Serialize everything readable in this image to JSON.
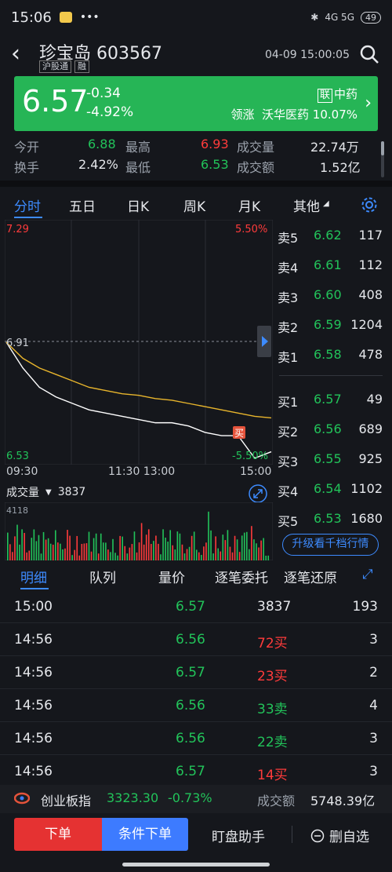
{
  "status": {
    "time": "15:06",
    "network": "4G 5G",
    "battery": "49"
  },
  "header": {
    "title": "珍宝岛 603567",
    "tags": [
      "沪股通",
      "融"
    ],
    "timestamp": "04-09 15:00:05"
  },
  "quote": {
    "price": "6.57",
    "change": "-0.34",
    "change_pct": "-4.92%",
    "sector": "中药",
    "sector_tag": "联",
    "leader_label": "领涨",
    "leader_name": "沃华医药",
    "leader_pct": "10.07%"
  },
  "stats": {
    "open_label": "今开",
    "open": "6.88",
    "high_label": "最高",
    "high": "6.93",
    "vol_label": "成交量",
    "vol": "22.74万",
    "turnover_label": "换手",
    "turnover": "2.42%",
    "low_label": "最低",
    "low": "6.53",
    "amount_label": "成交额",
    "amount": "1.52亿"
  },
  "tabs": [
    "分时",
    "五日",
    "日K",
    "周K",
    "月K",
    "其他"
  ],
  "chart_labels": {
    "top_price": "7.29",
    "top_pct": "5.50%",
    "ref_price": "6.91",
    "bottom_price": "6.53",
    "bottom_pct": "-5.50%",
    "buy_marker": "买",
    "time_start": "09:30",
    "time_mid": "11:30 13:00",
    "time_end": "15:00"
  },
  "chart_data": {
    "type": "line",
    "x": [
      "09:30",
      "09:45",
      "10:00",
      "10:15",
      "10:30",
      "10:45",
      "11:00",
      "11:15",
      "11:30",
      "13:15",
      "13:30",
      "13:45",
      "14:00",
      "14:15",
      "14:30",
      "14:45",
      "15:00"
    ],
    "series": [
      {
        "values": [
          6.91,
          6.83,
          6.77,
          6.74,
          6.72,
          6.7,
          6.69,
          6.68,
          6.67,
          6.66,
          6.66,
          6.65,
          6.63,
          6.62,
          6.62,
          6.55,
          6.57
        ]
      },
      {
        "values": [
          6.91,
          6.86,
          6.83,
          6.81,
          6.79,
          6.77,
          6.76,
          6.75,
          6.745,
          6.735,
          6.73,
          6.72,
          6.71,
          6.7,
          6.69,
          6.68,
          6.675
        ]
      }
    ],
    "ylim": [
      6.53,
      7.29
    ]
  },
  "orderbook": {
    "asks": [
      {
        "label": "卖5",
        "price": "6.62",
        "vol": "117"
      },
      {
        "label": "卖4",
        "price": "6.61",
        "vol": "112"
      },
      {
        "label": "卖3",
        "price": "6.60",
        "vol": "408"
      },
      {
        "label": "卖2",
        "price": "6.59",
        "vol": "1204"
      },
      {
        "label": "卖1",
        "price": "6.58",
        "vol": "478"
      }
    ],
    "bids": [
      {
        "label": "买1",
        "price": "6.57",
        "vol": "49"
      },
      {
        "label": "买2",
        "price": "6.56",
        "vol": "689"
      },
      {
        "label": "买3",
        "price": "6.55",
        "vol": "925"
      },
      {
        "label": "买4",
        "price": "6.54",
        "vol": "1102"
      },
      {
        "label": "买5",
        "price": "6.53",
        "vol": "1680"
      }
    ],
    "upgrade": "升级看千档行情"
  },
  "volume": {
    "label": "成交量",
    "value": "3837",
    "max": "4118"
  },
  "bottom_tabs": [
    "明细",
    "队列",
    "量价",
    "逐笔委托",
    "逐笔还原"
  ],
  "trades": [
    {
      "time": "15:00",
      "price": "6.57",
      "vol": "3837",
      "count": "193",
      "color": "green",
      "vcolor": "white"
    },
    {
      "time": "14:56",
      "price": "6.56",
      "vol": "72买",
      "count": "3",
      "color": "green",
      "vcolor": "red"
    },
    {
      "time": "14:56",
      "price": "6.57",
      "vol": "23买",
      "count": "2",
      "color": "green",
      "vcolor": "red"
    },
    {
      "time": "14:56",
      "price": "6.56",
      "vol": "33卖",
      "count": "4",
      "color": "green",
      "vcolor": "green"
    },
    {
      "time": "14:56",
      "price": "6.56",
      "vol": "22卖",
      "count": "3",
      "color": "green",
      "vcolor": "green"
    },
    {
      "time": "14:56",
      "price": "6.57",
      "vol": "14买",
      "count": "3",
      "color": "green",
      "vcolor": "red"
    }
  ],
  "index": {
    "name": "创业板指",
    "value": "3323.30",
    "pct": "-0.73%",
    "amount_label": "成交额",
    "amount": "5748.39亿"
  },
  "actions": {
    "order": "下单",
    "conditional": "条件下单",
    "helper": "盯盘助手",
    "remove_fav": "删自选"
  }
}
